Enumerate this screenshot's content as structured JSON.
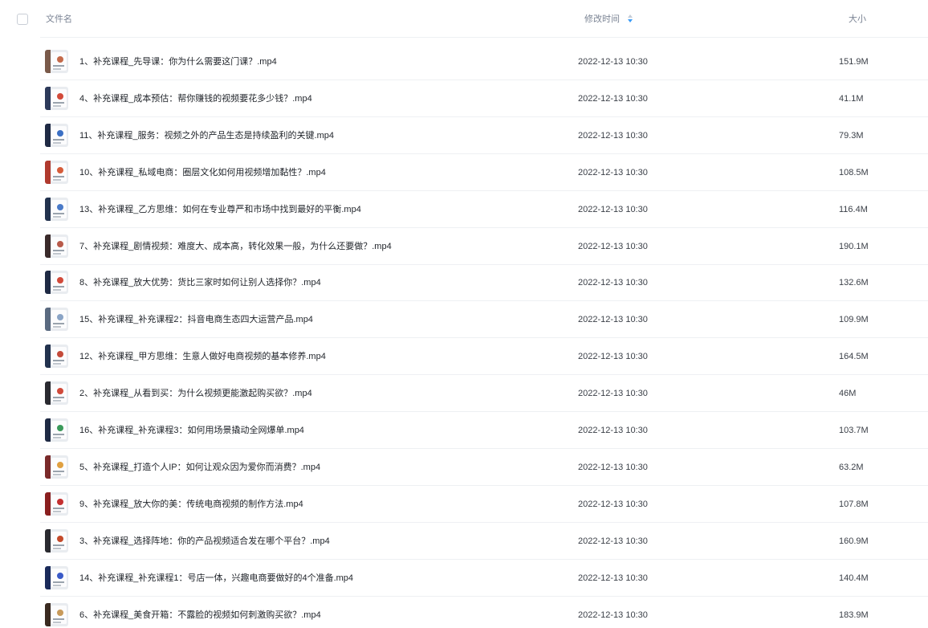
{
  "header": {
    "name_label": "文件名",
    "time_label": "修改时间",
    "size_label": "大小",
    "sort_icon": "sort-arrows-icon",
    "sort_accent": "#3b9cf7"
  },
  "files": [
    {
      "name": "1、补充课程_先导课：你为什么需要这门课？.mp4",
      "time": "2022-12-13 10:30",
      "size": "151.9M"
    },
    {
      "name": "4、补充课程_成本预估：帮你赚钱的视频要花多少钱？.mp4",
      "time": "2022-12-13 10:30",
      "size": "41.1M"
    },
    {
      "name": "11、补充课程_服务：视频之外的产品生态是持续盈利的关键.mp4",
      "time": "2022-12-13 10:30",
      "size": "79.3M"
    },
    {
      "name": "10、补充课程_私域电商：圈层文化如何用视频增加黏性？.mp4",
      "time": "2022-12-13 10:30",
      "size": "108.5M"
    },
    {
      "name": "13、补充课程_乙方思维：如何在专业尊严和市场中找到最好的平衡.mp4",
      "time": "2022-12-13 10:30",
      "size": "116.4M"
    },
    {
      "name": "7、补充课程_剧情视频：难度大、成本高，转化效果一般，为什么还要做？.mp4",
      "time": "2022-12-13 10:30",
      "size": "190.1M"
    },
    {
      "name": "8、补充课程_放大优势：货比三家时如何让别人选择你？.mp4",
      "time": "2022-12-13 10:30",
      "size": "132.6M"
    },
    {
      "name": "15、补充课程_补充课程2：抖音电商生态四大运营产品.mp4",
      "time": "2022-12-13 10:30",
      "size": "109.9M"
    },
    {
      "name": "12、补充课程_甲方思维：生意人做好电商视频的基本修养.mp4",
      "time": "2022-12-13 10:30",
      "size": "164.5M"
    },
    {
      "name": "2、补充课程_从看到买：为什么视频更能激起购买欲？.mp4",
      "time": "2022-12-13 10:30",
      "size": "46M"
    },
    {
      "name": "16、补充课程_补充课程3：如何用场景撬动全网爆单.mp4",
      "time": "2022-12-13 10:30",
      "size": "103.7M"
    },
    {
      "name": "5、补充课程_打造个人IP：如何让观众因为爱你而消费？.mp4",
      "time": "2022-12-13 10:30",
      "size": "63.2M"
    },
    {
      "name": "9、补充课程_放大你的美：传统电商视频的制作方法.mp4",
      "time": "2022-12-13 10:30",
      "size": "107.8M"
    },
    {
      "name": "3、补充课程_选择阵地：你的产品视频适合发在哪个平台？.mp4",
      "time": "2022-12-13 10:30",
      "size": "160.9M"
    },
    {
      "name": "14、补充课程_补充课程1：号店一体，兴趣电商要做好的4个准备.mp4",
      "time": "2022-12-13 10:30",
      "size": "140.4M"
    },
    {
      "name": "6、补充课程_美食开箱：不露脸的视频如何刺激购买欲？.mp4",
      "time": "2022-12-13 10:30",
      "size": "183.9M"
    }
  ],
  "thumb_colors": [
    {
      "band": "#7a5a4a",
      "spot": "#c46a4a"
    },
    {
      "band": "#2d3a5a",
      "spot": "#d24a3a"
    },
    {
      "band": "#1f2a44",
      "spot": "#3a6fc4"
    },
    {
      "band": "#b03a2e",
      "spot": "#d65c3a"
    },
    {
      "band": "#22324e",
      "spot": "#4a7ac8"
    },
    {
      "band": "#3a2a2a",
      "spot": "#b85a4a"
    },
    {
      "band": "#1f2a44",
      "spot": "#d24a3a"
    },
    {
      "band": "#5a6a80",
      "spot": "#8aa4c6"
    },
    {
      "band": "#22324e",
      "spot": "#c44a3a"
    },
    {
      "band": "#2a2a30",
      "spot": "#d04a3a"
    },
    {
      "band": "#1f2a44",
      "spot": "#3a9a5a"
    },
    {
      "band": "#7a2a2a",
      "spot": "#e0a040"
    },
    {
      "band": "#8a1f1f",
      "spot": "#c43030"
    },
    {
      "band": "#2a2a30",
      "spot": "#c44a2a"
    },
    {
      "band": "#1a2a5a",
      "spot": "#3a5ac8"
    },
    {
      "band": "#3a2a20",
      "spot": "#c89a5a"
    }
  ]
}
